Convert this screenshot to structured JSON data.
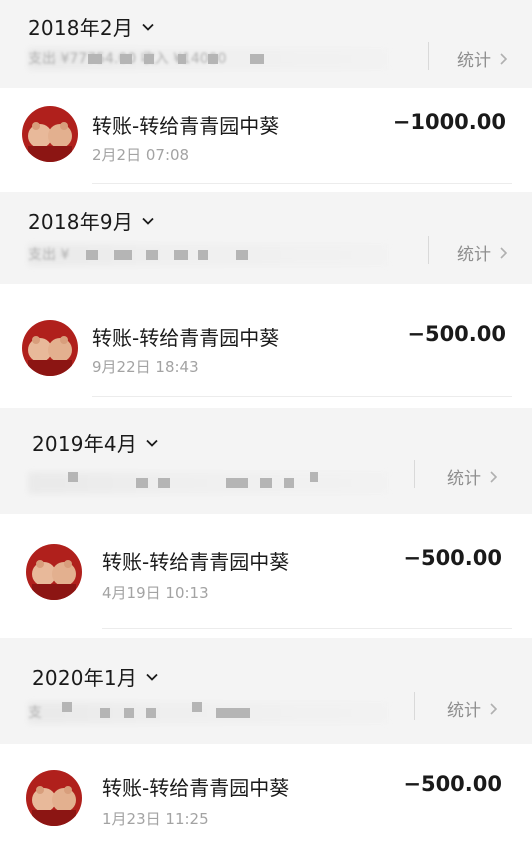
{
  "groups": [
    {
      "month": "2018年2月",
      "summary": "支出 ¥77754.00 收入 ¥14000",
      "stats_label": "统计",
      "tx": {
        "title": "转账-转给青青园中葵",
        "time": "2月2日 07:08",
        "amount": "−1000.00"
      }
    },
    {
      "month": "2018年9月",
      "summary": "支出 ¥",
      "stats_label": "统计",
      "tx": {
        "title": "转账-转给青青园中葵",
        "time": "9月22日 18:43",
        "amount": "−500.00"
      }
    },
    {
      "month": "2019年4月",
      "summary": "",
      "stats_label": "统计",
      "tx": {
        "title": "转账-转给青青园中葵",
        "time": "4月19日 10:13",
        "amount": "−500.00"
      }
    },
    {
      "month": "2020年1月",
      "summary": "支",
      "stats_label": "统计",
      "tx": {
        "title": "转账-转给青青园中葵",
        "time": "1月23日 11:25",
        "amount": "−500.00"
      }
    }
  ],
  "icons": {
    "dropdown": "chevron-down-icon",
    "stats_arrow": "chevron-right-icon",
    "avatar": "avatar"
  },
  "colors": {
    "header_bg": "#f4f4f4",
    "amount": "#1a1a1a",
    "secondary": "#a3a3a3"
  }
}
